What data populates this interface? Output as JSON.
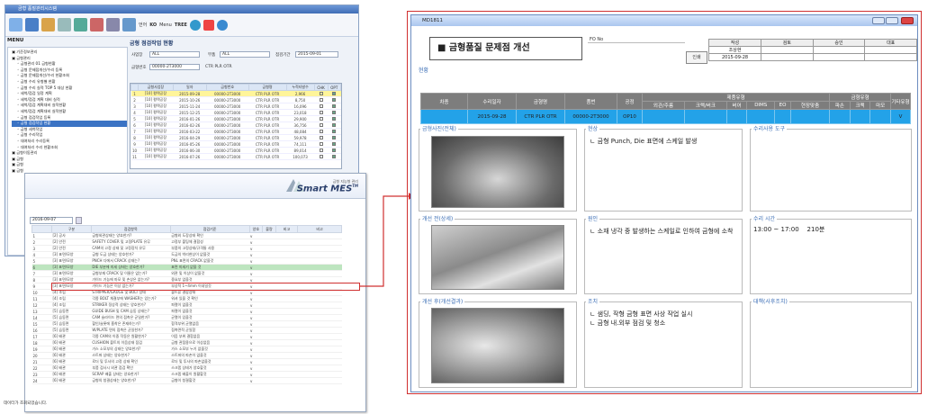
{
  "win1": {
    "title": "금형 품질관리시스템",
    "menu_label": "MENU",
    "toolbar": {
      "lang_label": "언어",
      "lang_value": "KO",
      "menu_label": "Menu",
      "menu_value": "TREE"
    },
    "tree": [
      {
        "lvl": 0,
        "t": "기준정보관리"
      },
      {
        "lvl": 0,
        "t": "금형관리"
      },
      {
        "lvl": 1,
        "t": "금형관리 01 금형현황"
      },
      {
        "lvl": 1,
        "t": "금형 문제점개선/수리 등록"
      },
      {
        "lvl": 1,
        "t": "금형 문제점개선/수리 현황조회"
      },
      {
        "lvl": 1,
        "t": "금형 수리 유형별 현황"
      },
      {
        "lvl": 1,
        "t": "금형 수리 실적 TOP 5 대상 현황"
      },
      {
        "lvl": 1,
        "t": "세척/점검 일정 계획"
      },
      {
        "lvl": 1,
        "t": "세척/점검 계획 대비 실적"
      },
      {
        "lvl": 1,
        "t": "세척/점검 계획대비 실적현황"
      },
      {
        "lvl": 1,
        "t": "세척/점검 계획대비 실적현황"
      },
      {
        "lvl": 1,
        "t": "금형 점검작업 등록"
      },
      {
        "lvl": 1,
        "t": "금형 점검작업 현황",
        "sel": true
      },
      {
        "lvl": 1,
        "t": "금형 세척작업"
      },
      {
        "lvl": 1,
        "t": "금형 수리작업"
      },
      {
        "lvl": 1,
        "t": "대여처리 수리등록"
      },
      {
        "lvl": 1,
        "t": "대여처리 수리 현황조회"
      },
      {
        "lvl": 0,
        "t": "금형이동관리"
      },
      {
        "lvl": 0,
        "t": "금형"
      },
      {
        "lvl": 0,
        "t": "금형"
      },
      {
        "lvl": 0,
        "t": "금형"
      }
    ],
    "panel_title": "금형 점검작업 현황",
    "filters": {
      "l1": "사업장",
      "v1": "ALL",
      "l2": "부품",
      "v2": "ALL",
      "l3": "점검기간",
      "v3": "2015-09-01",
      "l4": "금형번호",
      "v4": "00000-2T3000",
      "v5": "CTR PLR OTR"
    },
    "grid_headers": [
      "",
      "금형사업장",
      "일자",
      "금형번호",
      "금형명",
      "누적타발수",
      "CHK",
      "OPT"
    ],
    "grid_rows": [
      [
        "1",
        "[10] 평택공장",
        "2015-09-28",
        "00000-2T3000",
        "CTR PLR OTR",
        "2,966"
      ],
      [
        "2",
        "[10] 평택공장",
        "2015-10-26",
        "00000-2T3000",
        "CTR PLR OTR",
        "8,750"
      ],
      [
        "3",
        "[10] 평택공장",
        "2015-11-24",
        "00000-2T3000",
        "CTR PLR OTR",
        "16,096"
      ],
      [
        "4",
        "[10] 평택공장",
        "2015-12-25",
        "00000-2T3000",
        "CTR PLR OTR",
        "23,018"
      ],
      [
        "5",
        "[10] 평택공장",
        "2016-01-26",
        "00000-2T3000",
        "CTR PLR OTR",
        "29,900"
      ],
      [
        "6",
        "[10] 평택공장",
        "2016-02-26",
        "00000-2T3000",
        "CTR PLR OTR",
        "36,756"
      ],
      [
        "7",
        "[10] 평택공장",
        "2016-03-22",
        "00000-2T3000",
        "CTR PLR OTR",
        "48,084"
      ],
      [
        "8",
        "[10] 평택공장",
        "2016-04-29",
        "00000-2T3000",
        "CTR PLR OTR",
        "59,978"
      ],
      [
        "9",
        "[10] 평택공장",
        "2016-05-26",
        "00000-2T3000",
        "CTR PLR OTR",
        "74,111"
      ],
      [
        "10",
        "[10] 평택공장",
        "2016-06-30",
        "00000-2T3000",
        "CTR PLR OTR",
        "89,014"
      ],
      [
        "11",
        "[10] 평택공장",
        "2016-07-26",
        "00000-2T3000",
        "CTR PLR OTR",
        "100,073"
      ]
    ]
  },
  "win2": {
    "logo_small": "금형 지능형 관리",
    "logo_main": "Smart MES",
    "logo_tm": "TM",
    "date": "2016-09-07",
    "headers": [
      "",
      "구분",
      "점검항목",
      "점검기준",
      "양호",
      "불량",
      "비고",
      "비고"
    ],
    "rows": [
      [
        "1",
        "[2] 공사",
        "금형외관상태는 양호한가?",
        "금형외 도장상태 확인"
      ],
      [
        "2",
        "[2] 안전",
        "SAFETY COVER 및 고정PLATE 유무",
        "고정부 볼팅체 결합성"
      ],
      [
        "3",
        "[2] 안전",
        "CAM의 고정 상태 및 고정장치 유무",
        "부품의 고정상태/규격통 사용"
      ],
      [
        "4",
        "[3] 표면/모양",
        "금형 도금 상태는 양호한가?",
        "도금의 박리현상이 없을것"
      ],
      [
        "5",
        "[3] 표면/모양",
        "PNCH 다에서 CRACK 상태는?",
        "PNL 표면의 CRACK 없을것"
      ],
      [
        "6",
        "[3] 표면/모양",
        "DIE 부분에 미세 상태는 양호한가?",
        "표면 미세기 없을 것",
        "",
        true
      ],
      [
        "7",
        "[3] 표면/모양",
        "금형부재 CRACK 및 이물은 없는가?",
        "외관 및 이상이 없을것"
      ],
      [
        "8",
        "[3] 표면/모양",
        "가이드 기능에 마모 및 손상은 없는가?",
        "중요부 없을것"
      ],
      [
        "9",
        "[3] 표면/모양",
        "가이드 기능은 이상 없는가?",
        "부상적 1~4mm 이내일것"
      ],
      [
        "10",
        "[4] 조립",
        "STRIPPER/GAUGE 및 BOLT 상태",
        "볼트류 결합상태"
      ],
      [
        "11",
        "[4] 조립",
        "각종 BOLT 체결부에 WASHER는 있는가?",
        "워셔 있을 것 확인"
      ],
      [
        "12",
        "[4] 조립",
        "STRIKER 정상적 상태는 양호한가?",
        "파열이 없을것"
      ],
      [
        "13",
        "[5] 습동면",
        "GUIDE BUSH 및 CAM 습동 상태는?",
        "파열이 없을것"
      ],
      [
        "14",
        "[5] 습동면",
        "CAM 슬라이드 면의 접촉은 균일한가?",
        "균열이 있을것"
      ],
      [
        "15",
        "[5] 습동면",
        "할인/슬롯에 흡착은 존재하는가?",
        "합격부위 균열없음"
      ],
      [
        "16",
        "[5] 습동면",
        "W/PLATE 면의 접촉은 균일한가?",
        "접촉면적 균일함"
      ],
      [
        "17",
        "[6] 배관",
        "각종 CAM의 이중 작동은 원활한가?",
        "이음 부위 결함없음"
      ],
      [
        "18",
        "[6] 배관",
        "CUSHION 볼트의 이음상태 점검",
        "금형 관점용으로 이상없음"
      ],
      [
        "19",
        "[6] 배관",
        "가스 소모부의 상태는 양호한가?",
        "가스 소모부 누기 없을것"
      ],
      [
        "20",
        "[6] 배관",
        "스트퍼 상태는 양호한가?",
        "스트퍼의 파손이 없을것"
      ],
      [
        "21",
        "[6] 배관",
        "로더 및 투사의 고정 상태 확인",
        "로더 및 투사의 파손없을것"
      ],
      [
        "22",
        "[6] 배관",
        "부품 검사시 외관 점검 확인",
        "스크랩 상태가 양호할것"
      ],
      [
        "23",
        "[6] 배관",
        "SCRAP 배출 상태는 양호한가?",
        "스크랩 배출이 원활할것"
      ],
      [
        "24",
        "[6] 배관",
        "금형의 청결상태는 양호한가?",
        "금형이 청결할것"
      ]
    ],
    "side_note": "데이터가 조회되었습니다."
  },
  "win3": {
    "title": "MD1811",
    "doc_title": "■ 금형품질 문제점 개선",
    "fo_label": "FO No",
    "print_label": "인쇄",
    "approval_headers": [
      "작성",
      "검토",
      "승인",
      "대표"
    ],
    "approval_name": "조상현",
    "approval_date": "2015-09-28",
    "section_label": "현황",
    "defect_headers": {
      "h1": "차종",
      "h2": "수리일자",
      "h3": "금형명",
      "h4": "품번",
      "h5": "공정",
      "h6": "제품유형",
      "h7": "금형유형",
      "h8": "기타유형",
      "sub": [
        "외관/주름",
        "크랙/버크",
        "버어",
        "DIMS",
        "EO",
        "현장맞춤",
        "파손",
        "크랙",
        "마모"
      ]
    },
    "defect_row": {
      "date": "2015-09-28",
      "name": "CTR PLR OTR",
      "part": "00000-2T3000",
      "proc": "OP10",
      "extra": "V"
    },
    "cells": {
      "photo_before": "금형사진(전체)",
      "status": "현상",
      "status_text": "ㄴ 금형 Punch, Die 표면에 스케일 발생",
      "repair_tool": "수리사용 도구",
      "photo_detail": "개선 전(상세)",
      "cause": "원인",
      "cause_text": "ㄴ 소재 냉각 중 발생하는 스케일로 인하여 금형에 소착",
      "repair_time": "수리 시간",
      "repair_time_text": "13:00 ~ 17:00    210분",
      "photo_after": "개선 후(개선결과)",
      "action": "조치",
      "action_text1": "ㄴ 샘딩, 작형 금형 표면 사상 작업 실시",
      "action_text2": "ㄴ 금형 내.외부 점검 및 청소",
      "measure": "대책(사후조치)"
    }
  }
}
